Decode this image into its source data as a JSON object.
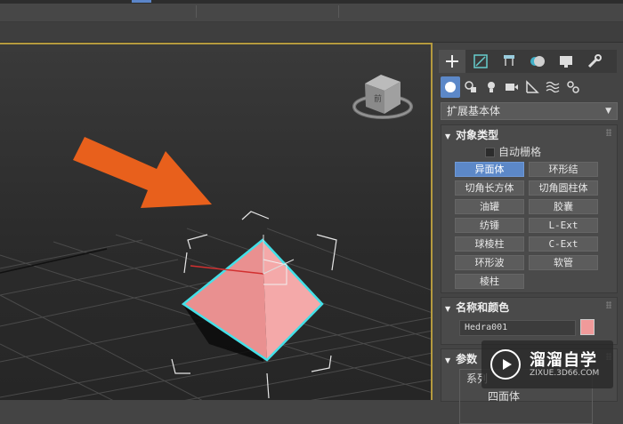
{
  "viewport": {
    "viewcube_label": "前"
  },
  "panel": {
    "tabs": [
      "create-plus-icon",
      "modify-icon",
      "hierarchy-icon",
      "motion-icon",
      "display-icon",
      "utilities-wrench-icon"
    ],
    "subtabs": [
      "geometry-sphere-icon",
      "shapes-icon",
      "lights-bulb-icon",
      "cameras-icon",
      "helpers-icon",
      "spacewarps-icon",
      "systems-icon"
    ],
    "category_dropdown": "扩展基本体",
    "object_type": {
      "title": "对象类型",
      "autogrid_label": "自动栅格",
      "buttons": [
        "异面体",
        "环形结",
        "切角长方体",
        "切角圆柱体",
        "油罐",
        "胶囊",
        "纺锤",
        "L-Ext",
        "球棱柱",
        "C-Ext",
        "环形波",
        "软管",
        "棱柱"
      ],
      "selected": "异面体"
    },
    "name_color": {
      "title": "名称和颜色",
      "object_name": "Hedra001",
      "color": "#f09a9a"
    },
    "params": {
      "title": "参数",
      "group_label": "系列",
      "option_label": "四面体"
    }
  },
  "watermark": {
    "title": "溜溜自学",
    "url": "ZIXUE.3D66.COM"
  },
  "colors": {
    "arrow": "#e8601c",
    "selection": "#44e0e8",
    "object": "#f0a0a0",
    "viewport_border": "#b59a3e"
  }
}
